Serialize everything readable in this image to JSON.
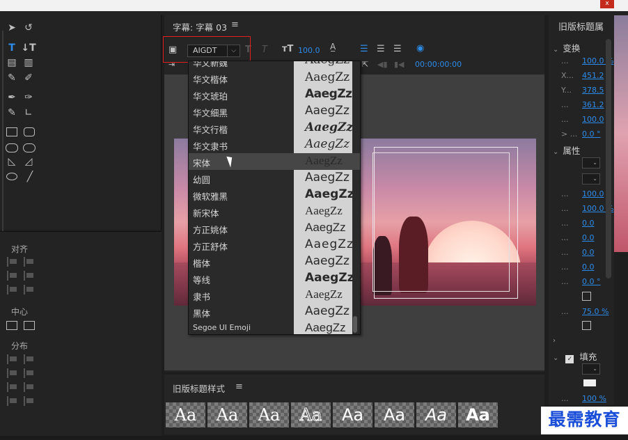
{
  "window": {
    "close_glyph": "x"
  },
  "tools_panel": {
    "icons": [
      "selection-tool",
      "rotate-tool",
      "type-tool",
      "vertical-type-tool",
      "area-type-tool",
      "vertical-area-type-tool",
      "path-type-tool",
      "vertical-path-type-tool",
      "pen-tool",
      "delete-anchor-tool",
      "add-anchor-tool",
      "convert-anchor-tool",
      "rectangle-tool",
      "rounded-rectangle-tool",
      "clipped-corner-tool",
      "rounded-corner-tool",
      "wedge-tool",
      "arc-tool",
      "ellipse-tool",
      "line-tool"
    ]
  },
  "align_panel": {
    "align_label": "对齐",
    "center_label": "中心",
    "distribute_label": "分布"
  },
  "title_panel": {
    "tab_title": "字幕: 字幕 03",
    "menu_glyph": "≡",
    "font_family": "AIGDT",
    "font_size": "100.0",
    "timecode": "00:00:00:00"
  },
  "font_dropdown": {
    "partial_top": "华文新魏",
    "hovered_index": 5,
    "fonts": [
      {
        "name": "华文楷体",
        "preview": "AaegZz"
      },
      {
        "name": "华文琥珀",
        "preview": "AaegZz"
      },
      {
        "name": "华文细黑",
        "preview": "AaegZz"
      },
      {
        "name": "华文行楷",
        "preview": "AaegZz"
      },
      {
        "name": "华文隶书",
        "preview": "AaegZz"
      },
      {
        "name": "宋体",
        "preview": "AaegZz"
      },
      {
        "name": "幼圆",
        "preview": "AaegZz"
      },
      {
        "name": "微软雅黑",
        "preview": "AaegZz"
      },
      {
        "name": "新宋体",
        "preview": "AaegZz"
      },
      {
        "name": "方正姚体",
        "preview": "AaegZz"
      },
      {
        "name": "方正舒体",
        "preview": "AaegZz"
      },
      {
        "name": "楷体",
        "preview": "AaegZz"
      },
      {
        "name": "等线",
        "preview": "AaegZz"
      },
      {
        "name": "隶书",
        "preview": "AaegZz"
      },
      {
        "name": "黑体",
        "preview": "AaegZz"
      },
      {
        "name": "Segoe UI Emoji",
        "preview": "AaegZz"
      }
    ]
  },
  "styles_panel": {
    "title": "旧版标题样式",
    "menu_glyph": "≡",
    "swatches": [
      "Aa",
      "Aa",
      "Aa",
      "Aa",
      "Aa",
      "Aa",
      "Aa",
      "Aa"
    ]
  },
  "properties_panel": {
    "title": "旧版标题属",
    "transform_label": "变换",
    "transform_rows": [
      {
        "label": "...",
        "value": "100.0 %"
      },
      {
        "label": "X...",
        "value": "451.2"
      },
      {
        "label": "Y...",
        "value": "378.5"
      },
      {
        "label": "...",
        "value": "361.2"
      },
      {
        "label": "...",
        "value": "100.0"
      },
      {
        "label": "> ...",
        "value": "0.0 °"
      }
    ],
    "attributes_label": "属性",
    "attribute_rows": [
      {
        "label": "...",
        "value": "100.0"
      },
      {
        "label": "...",
        "value": "100.0 %"
      },
      {
        "label": "...",
        "value": "0.0"
      },
      {
        "label": "...",
        "value": "0.0"
      },
      {
        "label": "...",
        "value": "0.0"
      },
      {
        "label": "...",
        "value": "0.0"
      },
      {
        "label": "...",
        "value": "0.0 °"
      }
    ],
    "tracking_value": "75.0 %",
    "fill_label": "填充",
    "fill_opacity": "100 %"
  },
  "watermark": "最需教育",
  "colors": {
    "accent": "#2d8ceb",
    "highlight_border": "#e0201c",
    "watermark_text": "#1a4ed8"
  }
}
